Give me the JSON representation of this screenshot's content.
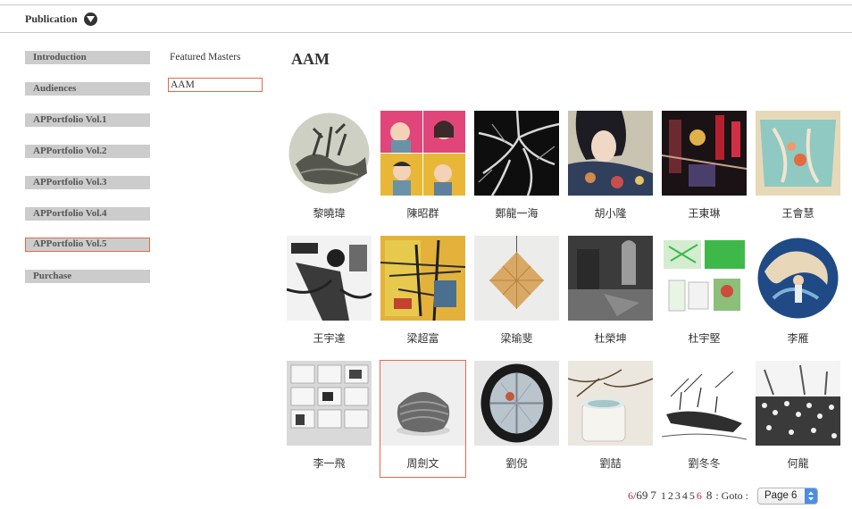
{
  "header": {
    "title": "Publication",
    "dropdown_icon": "chevron-down-icon"
  },
  "sidebar": {
    "items": [
      {
        "label": "Introduction"
      },
      {
        "label": "Audiences"
      },
      {
        "label": "APPortfolio Vol.1"
      },
      {
        "label": "APPortfolio Vol.2"
      },
      {
        "label": "APPortfolio Vol.3"
      },
      {
        "label": "APPortfolio Vol.4"
      },
      {
        "label": "APPortfolio Vol.5",
        "active": true
      },
      {
        "label": "Purchase"
      }
    ]
  },
  "subnav": {
    "items": [
      {
        "label": "Featured Masters"
      },
      {
        "label": "AAM",
        "active": true
      }
    ]
  },
  "main": {
    "title": "AAM",
    "artists": [
      {
        "name": "黎曉瑋"
      },
      {
        "name": "陳昭群"
      },
      {
        "name": "鄭龍一海"
      },
      {
        "name": "胡小隆"
      },
      {
        "name": "王東琳"
      },
      {
        "name": "王會慧"
      },
      {
        "name": "王宇達"
      },
      {
        "name": "梁超富"
      },
      {
        "name": "梁瑜斐"
      },
      {
        "name": "杜榮坤"
      },
      {
        "name": "杜宇堅"
      },
      {
        "name": "李雁"
      },
      {
        "name": "李一飛"
      },
      {
        "name": "周劍文",
        "active": true
      },
      {
        "name": "劉倪"
      },
      {
        "name": "劉喆"
      },
      {
        "name": "劉冬冬"
      },
      {
        "name": "何龍"
      }
    ]
  },
  "pagination": {
    "current": "6",
    "separator": "/",
    "total": "69",
    "next": "7",
    "pages": [
      "1",
      "2",
      "3",
      "4",
      "5",
      "6"
    ],
    "current_page": "6",
    "last": "8",
    "goto_label": ": Goto :",
    "select_value": "Page 6"
  },
  "colors": {
    "accent": "#e8674a",
    "sidebar_bg": "#cccccc",
    "page_current": "#cc2a2a",
    "select_arrow": "#4a8ee8"
  }
}
